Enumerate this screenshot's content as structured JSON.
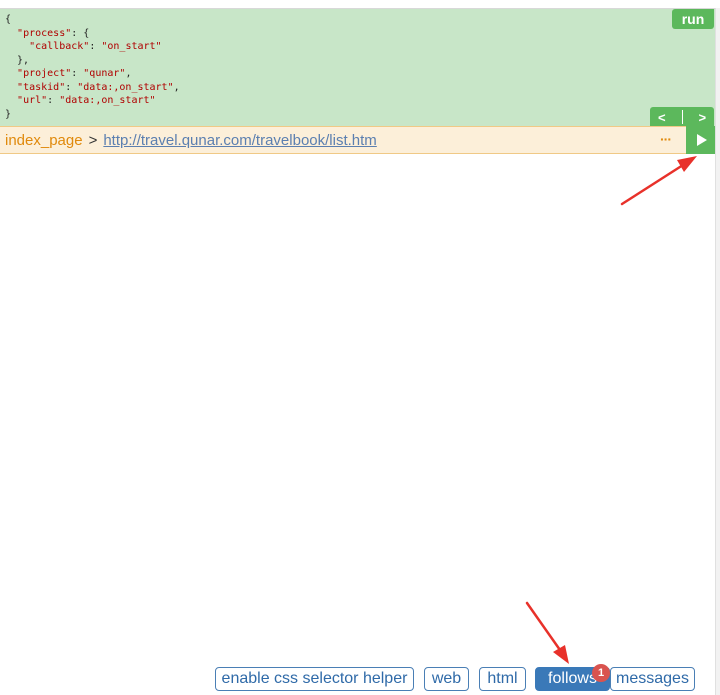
{
  "task_panel": {
    "code_lines": [
      [
        "{"
      ],
      [
        "  ",
        {
          "k": "\"process\""
        },
        ": {"
      ],
      [
        "    ",
        {
          "k": "\"callback\""
        },
        ": ",
        {
          "k": "\"on_start\""
        }
      ],
      [
        "  },"
      ],
      [
        "  ",
        {
          "k": "\"project\""
        },
        ": ",
        {
          "k": "\"qunar\""
        },
        ","
      ],
      [
        "  ",
        {
          "k": "\"taskid\""
        },
        ": ",
        {
          "k": "\"data:,on_start\""
        },
        ","
      ],
      [
        "  ",
        {
          "k": "\"url\""
        },
        ": ",
        {
          "k": "\"data:,on_start\""
        }
      ],
      [
        "}"
      ]
    ],
    "run_label": "run",
    "prev_label": "<",
    "next_label": ">"
  },
  "url_bar": {
    "callback": "index_page",
    "separator": ">",
    "url": "http://travel.qunar.com/travelbook/list.htm",
    "more_label": "···"
  },
  "tabs": [
    {
      "label": "enable css selector helper",
      "active": false
    },
    {
      "label": "web",
      "active": false
    },
    {
      "label": "html",
      "active": false
    },
    {
      "label": "follows",
      "active": true
    },
    {
      "label": "messages",
      "active": false
    }
  ],
  "follows_badge": "1",
  "colors": {
    "panel_green": "#c8e6c8",
    "button_green": "#5cb85c",
    "url_bar_bg": "#fcefd9",
    "callback_orange": "#e08a0d",
    "tab_blue": "#3a79b8",
    "badge_red": "#d9534f",
    "annotation_red": "#e8312a"
  }
}
